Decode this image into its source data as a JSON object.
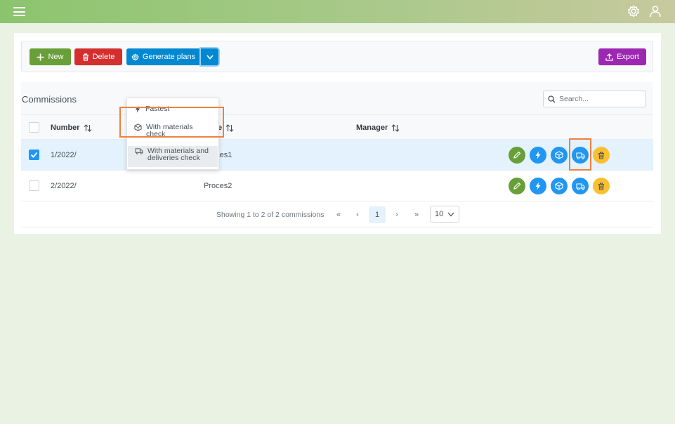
{
  "toolbar": {
    "new_label": "New",
    "delete_label": "Delete",
    "generate_label": "Generate plans",
    "export_label": "Export"
  },
  "generate_menu": {
    "items": [
      {
        "label_line1": "Fastest",
        "label_line2": "",
        "icon": "lightning-icon"
      },
      {
        "label_line1": "With materials",
        "label_line2": "check",
        "icon": "box-icon"
      },
      {
        "label_line1": "With materials and",
        "label_line2": "deliveries check",
        "icon": "truck-icon"
      }
    ]
  },
  "table": {
    "title": "Commissions",
    "search_placeholder": "Search...",
    "columns": [
      "Number",
      "e",
      "Manager"
    ],
    "rows": [
      {
        "number": "1/2022/",
        "process": "Proces1",
        "manager": "",
        "selected": true
      },
      {
        "number": "2/2022/",
        "process": "Proces2",
        "manager": "",
        "selected": false
      }
    ]
  },
  "pagination": {
    "summary": "Showing 1 to 2 of 2 commissions",
    "first": "«",
    "prev": "‹",
    "current_page": "1",
    "next": "›",
    "last": "»",
    "rows_per_page": "10"
  },
  "colors": {
    "success": "#689f38",
    "danger": "#d32f2f",
    "primary": "#0288d1",
    "info": "#2196f3",
    "warning": "#fbc02d",
    "help": "#9c27b0",
    "highlight": "#f0803c"
  }
}
